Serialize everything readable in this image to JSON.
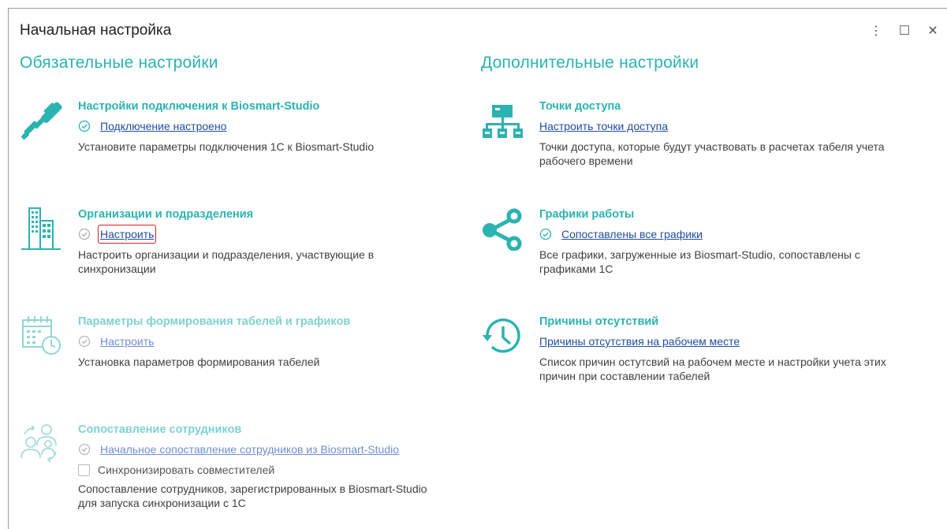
{
  "window": {
    "title": "Начальная настройка",
    "controls": {
      "menu": "⋮",
      "maximize": "☐",
      "close": "✕"
    }
  },
  "left": {
    "heading": "Обязательные настройки",
    "items": [
      {
        "title": "Настройки подключения к Biosmart-Studio",
        "link": "Подключение настроено",
        "description": "Установите параметры подключения 1С к Biosmart-Studio"
      },
      {
        "title": "Организации и подразделения",
        "link": "Настроить",
        "description": "Настроить организации и подразделения, участвующие в синхронизации"
      },
      {
        "title": "Параметры формирования табелей и графиков",
        "link": "Настроить",
        "description": "Установка параметров формирования табелей"
      },
      {
        "title": "Сопоставление сотрудников",
        "link": "Начальное сопоставление сотрудников из Biosmart-Studio",
        "checkbox_label": "Синхронизировать совместителей",
        "description": "Сопоставление сотрудников, зарегистрированных в Biosmart-Studio для запуска синхронизации с 1С"
      }
    ]
  },
  "right": {
    "heading": "Дополнительные настройки",
    "items": [
      {
        "title": "Точки доступа",
        "link": "Настроить точки доступа",
        "description": "Точки доступа, которые будут участвовать в расчетах табеля учета рабочего времени"
      },
      {
        "title": "Графики работы",
        "link": "Сопоставлены все графики",
        "description": "Все графики, загруженные из Biosmart-Studio, сопоставлены с графиками 1С"
      },
      {
        "title": "Причины отсутствий",
        "link": "Причины отсутствия на рабочем месте",
        "description": "Список причин остутсвий на рабочем месте и настройки учета этих причин при составлении табелей"
      }
    ]
  },
  "colors": {
    "accent": "#2bb3b1",
    "accent_faded": "#7fd2cf",
    "link": "#1f4ea0",
    "highlight_border": "#d42020"
  }
}
